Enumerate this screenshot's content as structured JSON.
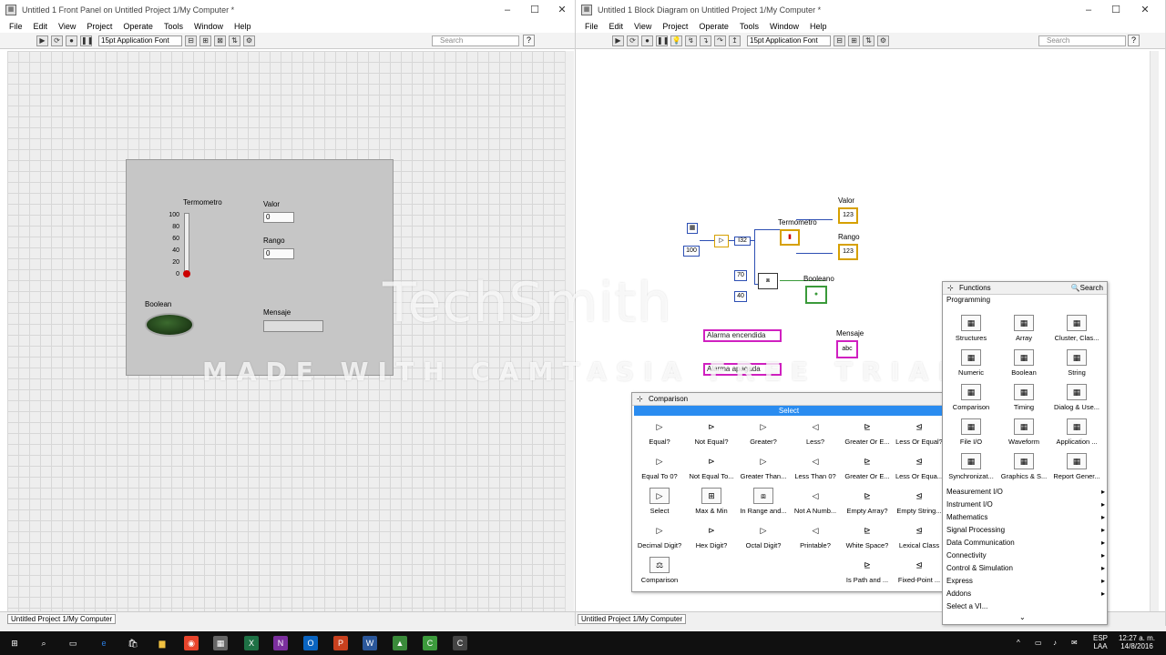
{
  "front_panel": {
    "title": "Untitled 1 Front Panel on Untitled Project 1/My Computer *",
    "menu": [
      "File",
      "Edit",
      "View",
      "Project",
      "Operate",
      "Tools",
      "Window",
      "Help"
    ],
    "font": "15pt Application Font",
    "search_placeholder": "Search",
    "status": "Untitled Project 1/My Computer",
    "controls": {
      "thermometer_label": "Termometro",
      "scale": [
        "100",
        "80",
        "60",
        "40",
        "20",
        "0"
      ],
      "valor_label": "Valor",
      "valor_value": "0",
      "rango_label": "Rango",
      "rango_value": "0",
      "boolean_label": "Boolean",
      "mensaje_label": "Mensaje"
    }
  },
  "block_diagram": {
    "title": "Untitled 1 Block Diagram on Untitled Project 1/My Computer *",
    "menu": [
      "File",
      "Edit",
      "View",
      "Project",
      "Operate",
      "Tools",
      "Window",
      "Help"
    ],
    "font": "15pt Application Font",
    "search_placeholder": "Search",
    "status": "Untitled Project 1/My Computer",
    "nodes": {
      "const_100": "100",
      "const_70": "70",
      "const_40": "40",
      "i32": "I32",
      "termometro_label": "Termometro",
      "valor_label": "Valor",
      "rango_label": "Rango",
      "booleano_label": "Booleano",
      "mensaje_label": "Mensaje",
      "alarma_on": "Alarma encendida",
      "alarma_off": "Alarma apagada",
      "i123": "123",
      "abc": "abc"
    }
  },
  "comparison_palette": {
    "title": "Comparison",
    "selected": "Select",
    "items": [
      [
        "Equal?",
        "Not Equal?",
        "Greater?",
        "Less?",
        "Greater Or E...",
        "Less Or Equal?"
      ],
      [
        "Equal To 0?",
        "Not Equal To...",
        "Greater Than...",
        "Less Than 0?",
        "Greater Or E...",
        "Less Or Equa..."
      ],
      [
        "Select",
        "Max & Min",
        "In Range and...",
        "Not A Numb...",
        "Empty Array?",
        "Empty String..."
      ],
      [
        "Decimal Digit?",
        "Hex Digit?",
        "Octal Digit?",
        "Printable?",
        "White Space?",
        "Lexical Class"
      ],
      [
        "Comparison",
        "",
        "",
        "",
        "Is Path and ...",
        "Fixed-Point ..."
      ]
    ]
  },
  "functions_palette": {
    "title": "Functions",
    "search": "Search",
    "category": "Programming",
    "grid": [
      [
        "Structures",
        "Array",
        "Cluster, Clas..."
      ],
      [
        "Numeric",
        "Boolean",
        "String"
      ],
      [
        "Comparison",
        "Timing",
        "Dialog & Use..."
      ],
      [
        "File I/O",
        "Waveform",
        "Application ..."
      ],
      [
        "Synchronizat...",
        "Graphics & S...",
        "Report Gener..."
      ]
    ],
    "list": [
      "Measurement I/O",
      "Instrument I/O",
      "Mathematics",
      "Signal Processing",
      "Data Communication",
      "Connectivity",
      "Control & Simulation",
      "Express",
      "Addons",
      "Select a VI..."
    ]
  },
  "watermark": {
    "brand": "TechSmith",
    "text": "MADE WITH CAMTASIA FREE TRIAL"
  },
  "taskbar": {
    "lang": "ESP",
    "lang2": "LAA",
    "time": "12:27 a. m.",
    "date": "14/8/2016"
  }
}
